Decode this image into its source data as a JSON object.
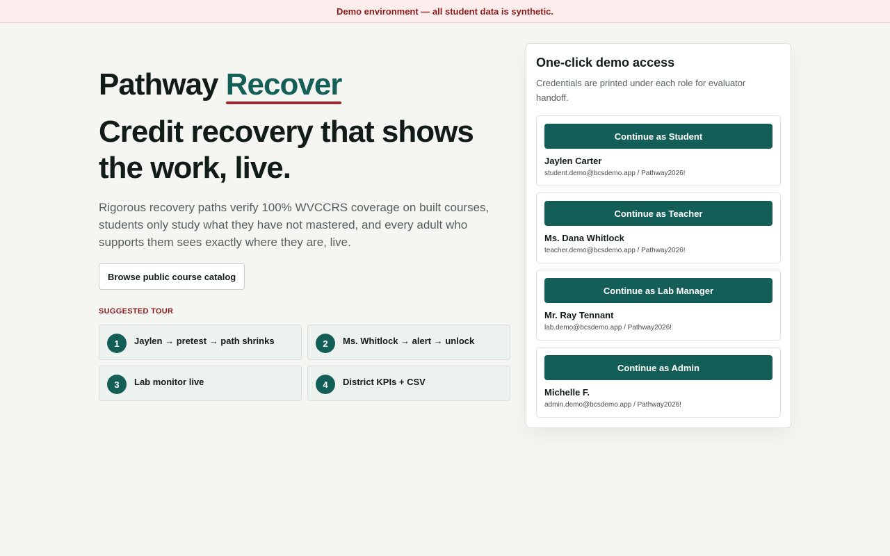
{
  "banner": {
    "text": "Demo environment — all student data is synthetic."
  },
  "brand": {
    "name": "Pathway",
    "accent": "Recover"
  },
  "hero": {
    "headline": "Credit recovery that shows the work, live.",
    "lede": "Rigorous recovery paths verify 100% WVCCRS coverage on built courses, students only study what they have not mastered, and every adult who supports them sees exactly where they are, live.",
    "catalog_button": "Browse public course catalog"
  },
  "tour": {
    "label": "SUGGESTED TOUR",
    "steps": [
      {
        "num": "1",
        "label": "Jaylen → pretest → path shrinks"
      },
      {
        "num": "2",
        "label": "Ms. Whitlock → alert → unlock"
      },
      {
        "num": "3",
        "label": "Lab monitor live"
      },
      {
        "num": "4",
        "label": "District KPIs + CSV"
      }
    ]
  },
  "demo": {
    "title": "One-click demo access",
    "subtitle": "Credentials are printed under each role for evaluator handoff.",
    "roles": [
      {
        "button": "Continue as Student",
        "name": "Jaylen Carter",
        "creds": "student.demo@bcsdemo.app / Pathway2026!"
      },
      {
        "button": "Continue as Teacher",
        "name": "Ms. Dana Whitlock",
        "creds": "teacher.demo@bcsdemo.app / Pathway2026!"
      },
      {
        "button": "Continue as Lab Manager",
        "name": "Mr. Ray Tennant",
        "creds": "lab.demo@bcsdemo.app / Pathway2026!"
      },
      {
        "button": "Continue as Admin",
        "name": "Michelle F.",
        "creds": "admin.demo@bcsdemo.app / Pathway2026!"
      }
    ]
  },
  "colors": {
    "brand_green": "#135e57",
    "accent_red": "#9a2a32",
    "banner_bg": "#fdeeed",
    "page_bg": "#f5f5f2"
  }
}
